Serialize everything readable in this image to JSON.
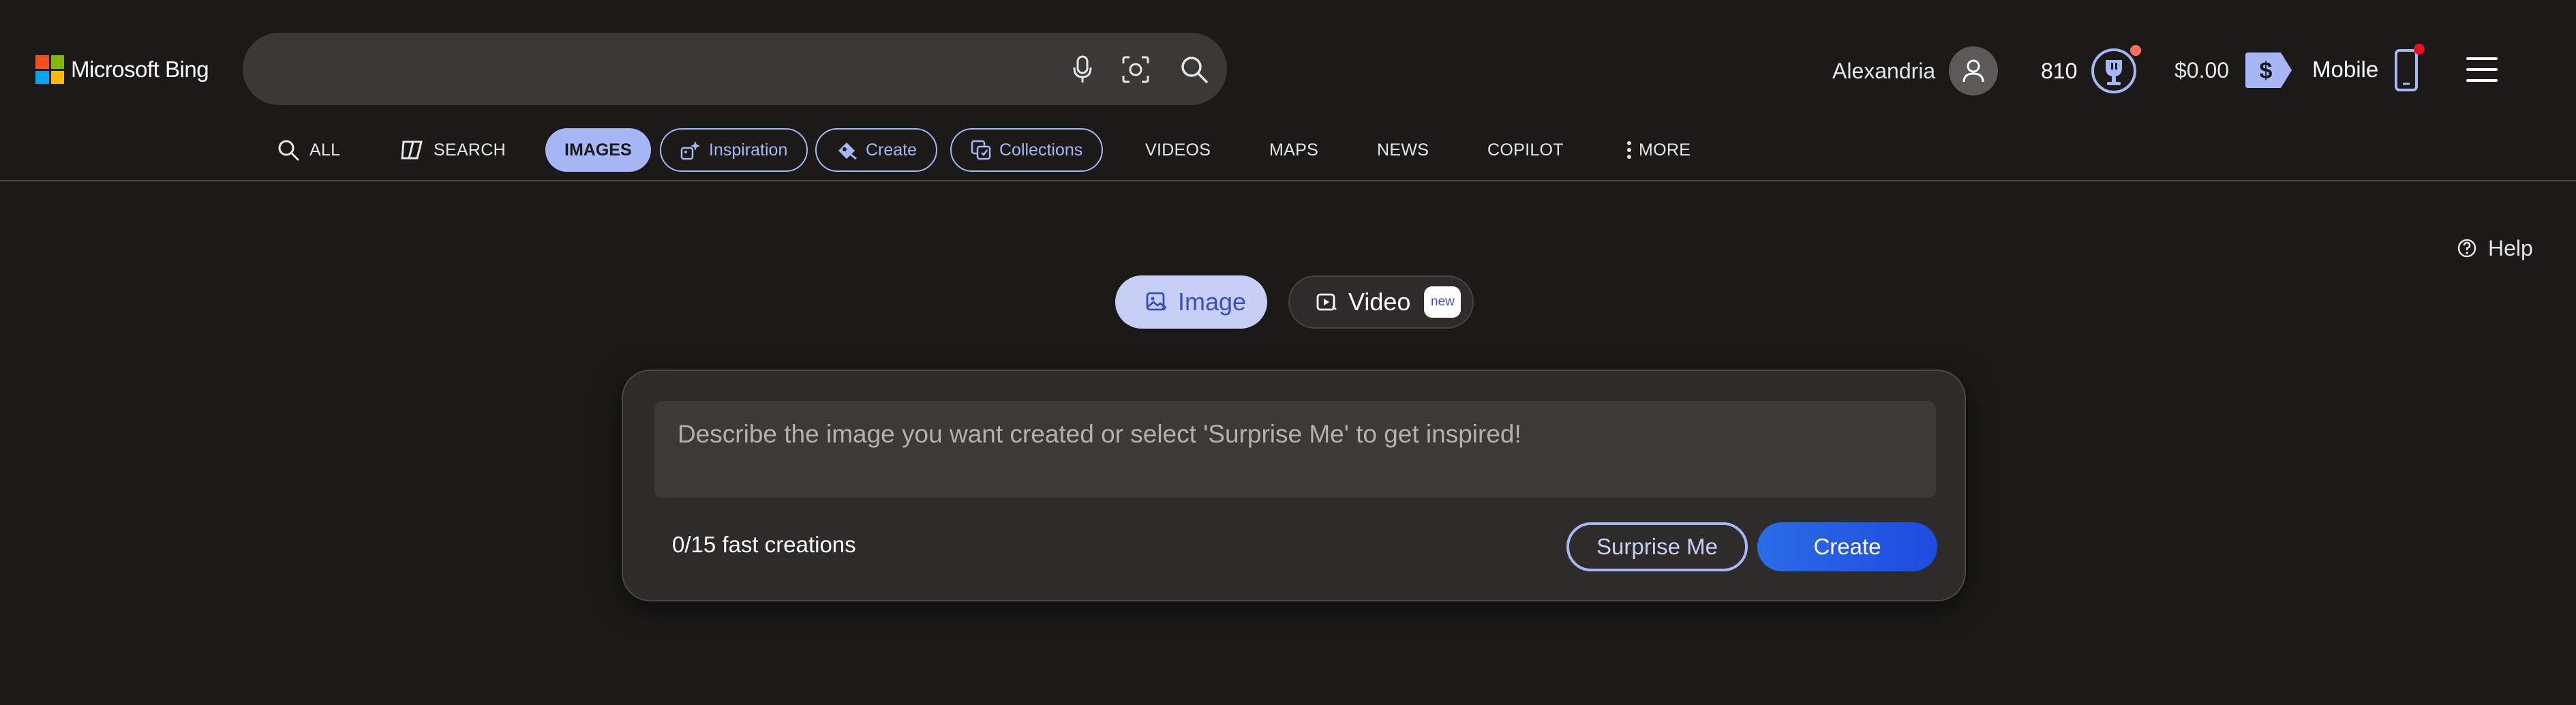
{
  "header": {
    "brand": "Microsoft Bing",
    "brand_colors": [
      "#f25022",
      "#7fba00",
      "#00a4ef",
      "#ffb900"
    ],
    "search": {
      "value": "",
      "placeholder": ""
    },
    "search_icons": [
      "microphone-icon",
      "visual-search-icon",
      "search-icon"
    ],
    "user_name": "Alexandria",
    "rewards_points": "810",
    "balance": "$0.00",
    "balance_icon_symbol": "$",
    "mobile_label": "Mobile",
    "menu_icon": "hamburger-icon"
  },
  "nav": {
    "all": "ALL",
    "search": "SEARCH",
    "images": "IMAGES",
    "inspiration": "Inspiration",
    "create": "Create",
    "collections": "Collections",
    "videos": "VIDEOS",
    "maps": "MAPS",
    "news": "NEWS",
    "copilot": "COPILOT",
    "more": "MORE",
    "active": "IMAGES"
  },
  "main": {
    "help": "Help",
    "tabs": {
      "image": "Image",
      "video": "Video",
      "video_badge": "new",
      "selected": "Image"
    },
    "prompt": {
      "value": "",
      "placeholder": "Describe the image you want created or select 'Surprise Me' to get inspired!"
    },
    "fast_creations": "0/15 fast creations",
    "surprise_button": "Surprise Me",
    "create_button": "Create"
  },
  "colors": {
    "background": "#1b1a19",
    "accent": "#a7b6f5",
    "create_button": "#2563eb",
    "notification": "#ff6f61"
  }
}
